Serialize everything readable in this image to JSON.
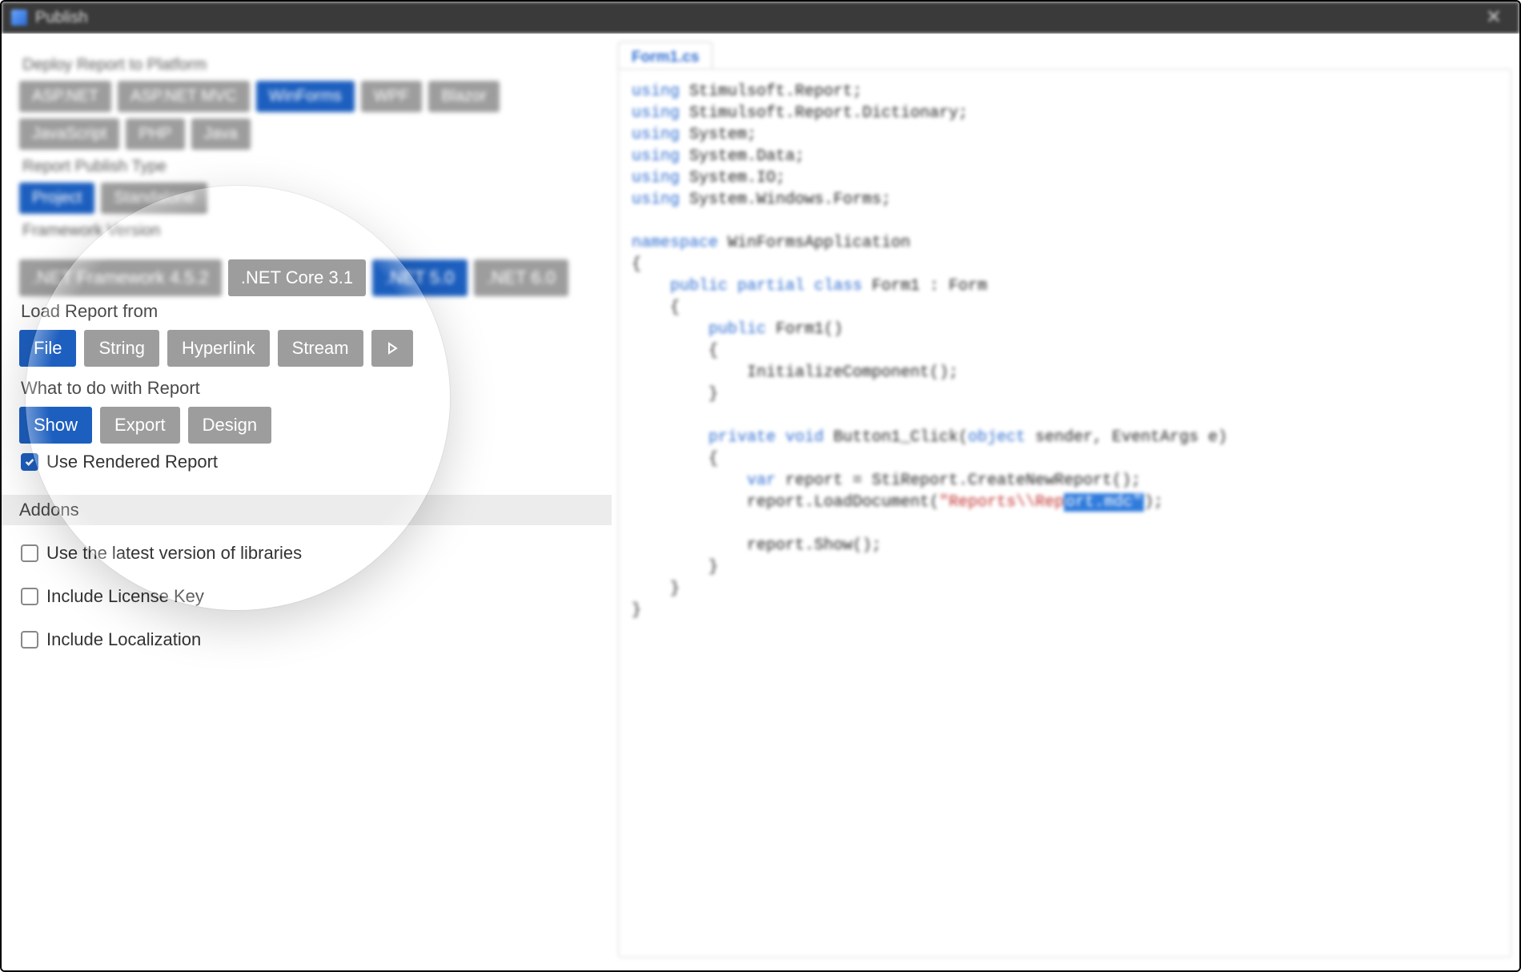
{
  "title": "Publish",
  "sections": {
    "deploy": {
      "label": "Deploy Report to Platform",
      "items": [
        "ASP.NET",
        "ASP.NET MVC",
        "WinForms",
        "WPF",
        "Blazor",
        "JavaScript",
        "PHP",
        "Java"
      ],
      "active": "WinForms"
    },
    "type": {
      "label": "Report Publish Type",
      "items": [
        "Project",
        "Standalone"
      ],
      "active": "Project"
    },
    "framework": {
      "label": "Framework Version",
      "items": [
        ".NET Framework 4.5.2",
        ".NET Core 3.1",
        ".NET 5.0",
        ".NET 6.0"
      ],
      "active": ".NET 5.0"
    },
    "load": {
      "label": "Load Report from",
      "items": [
        "File",
        "String",
        "Hyperlink",
        "Stream",
        "▷"
      ],
      "active": "File"
    },
    "action": {
      "label": "What to do with Report",
      "items": [
        "Show",
        "Export",
        "Design"
      ],
      "active": "Show",
      "useRendered": "Use Rendered Report"
    },
    "addons": {
      "label": "Addons",
      "items": [
        "Use the latest version of libraries",
        "Include License Key",
        "Include Localization"
      ]
    }
  },
  "codeTab": "Form1.cs",
  "code": {
    "l1a": "using",
    "l1b": " Stimulsoft.Report;",
    "l2a": "using",
    "l2b": " Stimulsoft.Report.Dictionary;",
    "l3a": "using",
    "l3b": " System;",
    "l4a": "using",
    "l4b": " System.Data;",
    "l5a": "using",
    "l5b": " System.IO;",
    "l6a": "using",
    "l6b": " System.Windows.Forms;",
    "ns": "namespace",
    "nsn": " WinFormsApplication",
    "ob": "{",
    "pub": "    public partial class",
    "cls": " Form1 : Form",
    "ob2": "    {",
    "ctor1": "        public",
    "ctor2": " Form1()",
    "ob3": "        {",
    "init": "            InitializeComponent();",
    "cb3": "        }",
    "mtd1": "        private void",
    "mtd2": " Button1_Click(",
    "mtd3": "object",
    "mtd4": " sender, EventArgs e)",
    "ob4": "        {",
    "var1": "            var",
    "var2": " report = StiReport.CreateNewReport();",
    "ld1": "            report.LoadDocument(",
    "ld2": "\"Reports\\\\Rep",
    "ldSel": "ort.mdc\"",
    "ld3": ");",
    "shw": "            report.Show();",
    "cb4": "        }",
    "cb2": "    }",
    "cb": "}"
  }
}
